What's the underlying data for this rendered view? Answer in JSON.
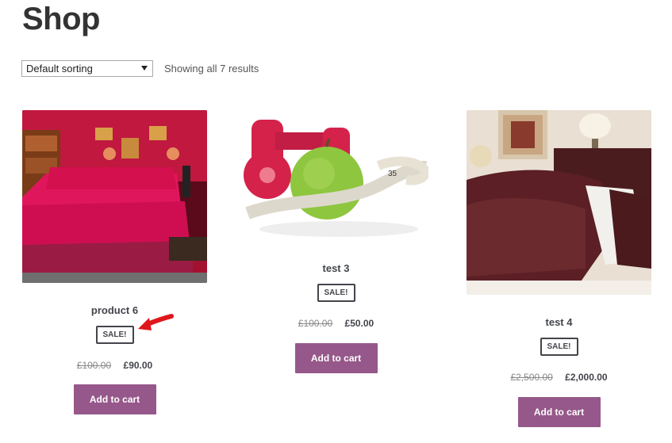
{
  "page": {
    "title": "Shop"
  },
  "toolbar": {
    "sort_selected": "Default sorting",
    "result_count": "Showing all 7 results"
  },
  "products": [
    {
      "name": "product 6",
      "badge": "SALE!",
      "old_price": "£100.00",
      "new_price": "£90.00",
      "button_label": "Add to cart",
      "image_desc_icon": "bedroom-pink-image"
    },
    {
      "name": "test 3",
      "badge": "SALE!",
      "old_price": "£100.00",
      "new_price": "£50.00",
      "button_label": "Add to cart",
      "image_desc_icon": "fitness-apple-image"
    },
    {
      "name": "test 4",
      "badge": "SALE!",
      "old_price": "£2,500.00",
      "new_price": "£2,000.00",
      "button_label": "Add to cart",
      "image_desc_icon": "bedroom-brown-image"
    }
  ],
  "colors": {
    "button": "#96588a",
    "text": "#43454b",
    "annotation_arrow": "#e0161b"
  }
}
